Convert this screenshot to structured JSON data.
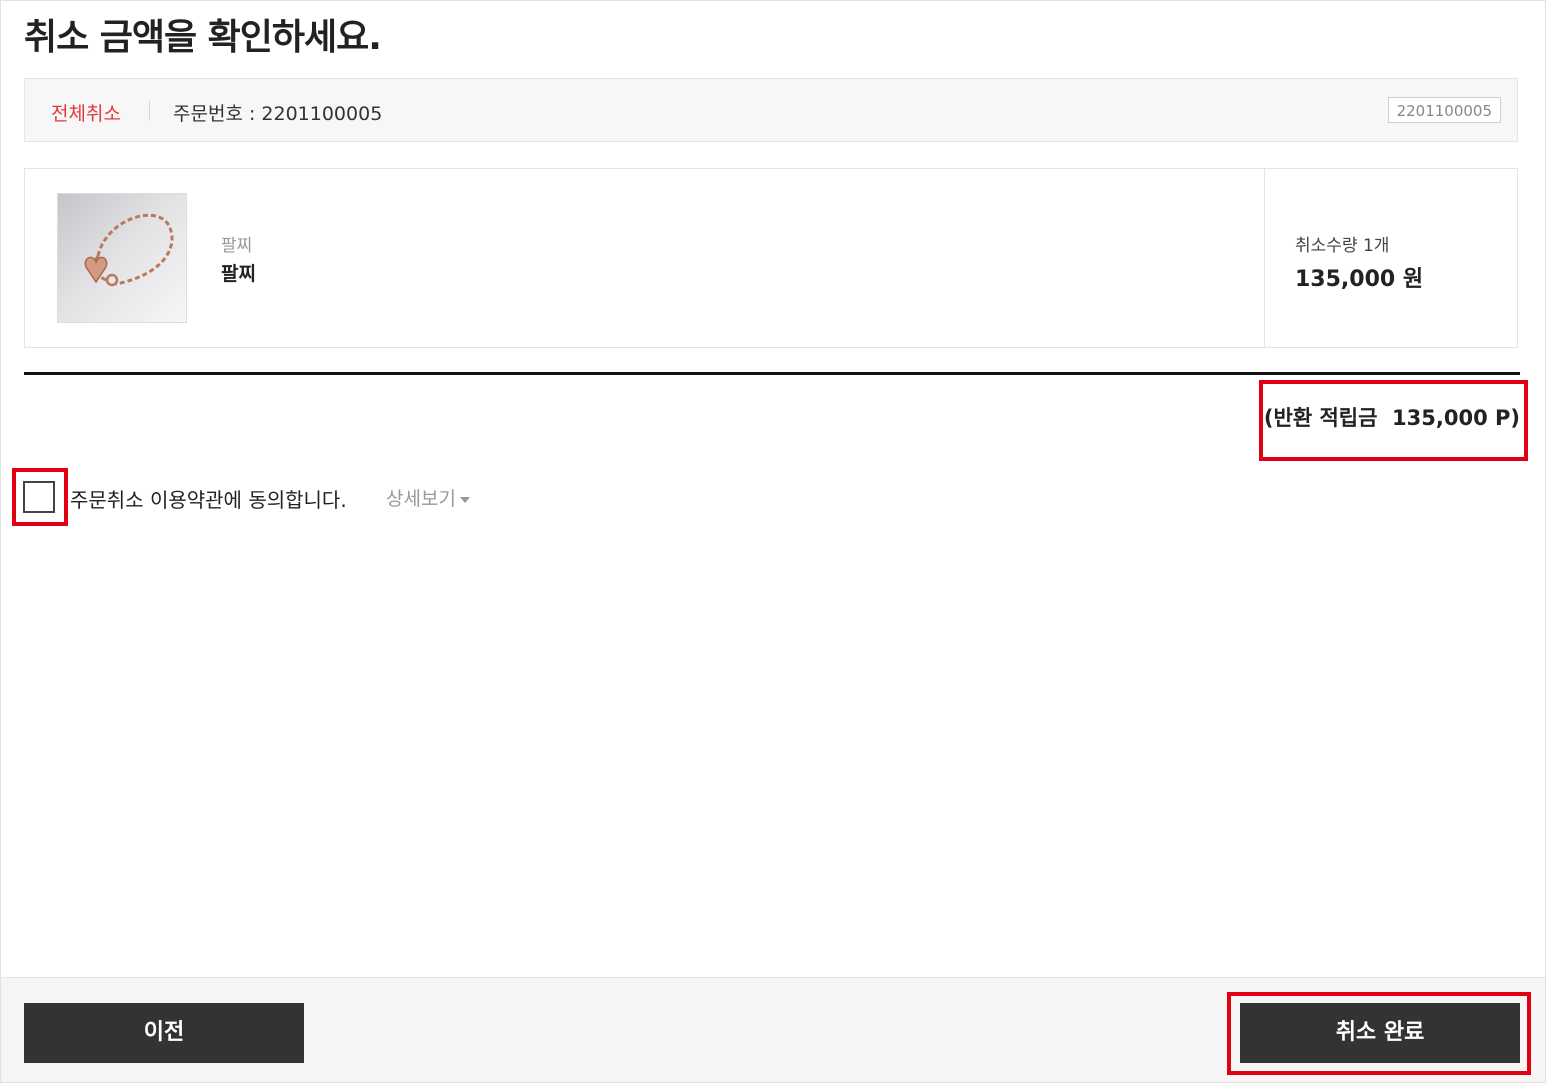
{
  "header": {
    "title": "취소 금액을 확인하세요."
  },
  "order": {
    "type_label": "전체취소",
    "number_label": "주문번호 : 2201100005",
    "number_badge": "2201100005"
  },
  "product": {
    "subtitle": "팔찌",
    "name": "팔찌",
    "cancel_qty": "취소수량 1개",
    "price": "135,000 원"
  },
  "summary": {
    "refund_points": "(반환 적립금  135,000 P)"
  },
  "agreement": {
    "label": "주문취소 이용약관에 동의합니다.",
    "detail_link": "상세보기",
    "checked": false
  },
  "footer": {
    "prev_label": "이전",
    "complete_label": "취소 완료"
  },
  "colors": {
    "accent_red": "#e03a3a",
    "highlight": "#e00012",
    "button_bg": "#333333"
  }
}
